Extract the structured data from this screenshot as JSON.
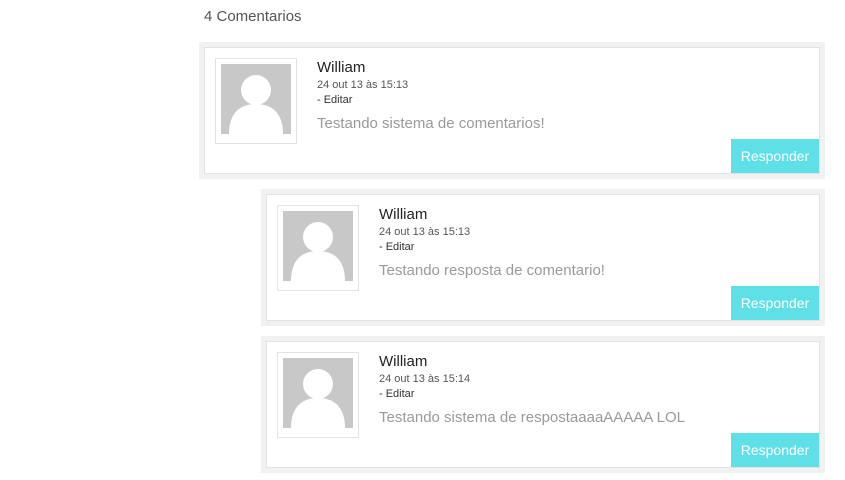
{
  "heading": "4 Comentarios",
  "comments": [
    {
      "author": "William",
      "date": "24 out 13 às 15:13",
      "edit_label": "- Editar",
      "text": "Testando sistema de comentarios!",
      "reply_label": "Responder"
    },
    {
      "author": "William",
      "date": "24 out 13 às 15:13",
      "edit_label": "- Editar",
      "text": "Testando resposta de comentario!",
      "reply_label": "Responder"
    },
    {
      "author": "William",
      "date": "24 out 13 às 15:14",
      "edit_label": "- Editar",
      "text": "Testando sistema de respostaaaaAAAAA LOL",
      "reply_label": "Responder"
    }
  ],
  "colors": {
    "reply_button": "#5fdfe6",
    "avatar_placeholder": "#c8c8c8"
  },
  "icons": {
    "avatar": "default-user-avatar-icon"
  }
}
